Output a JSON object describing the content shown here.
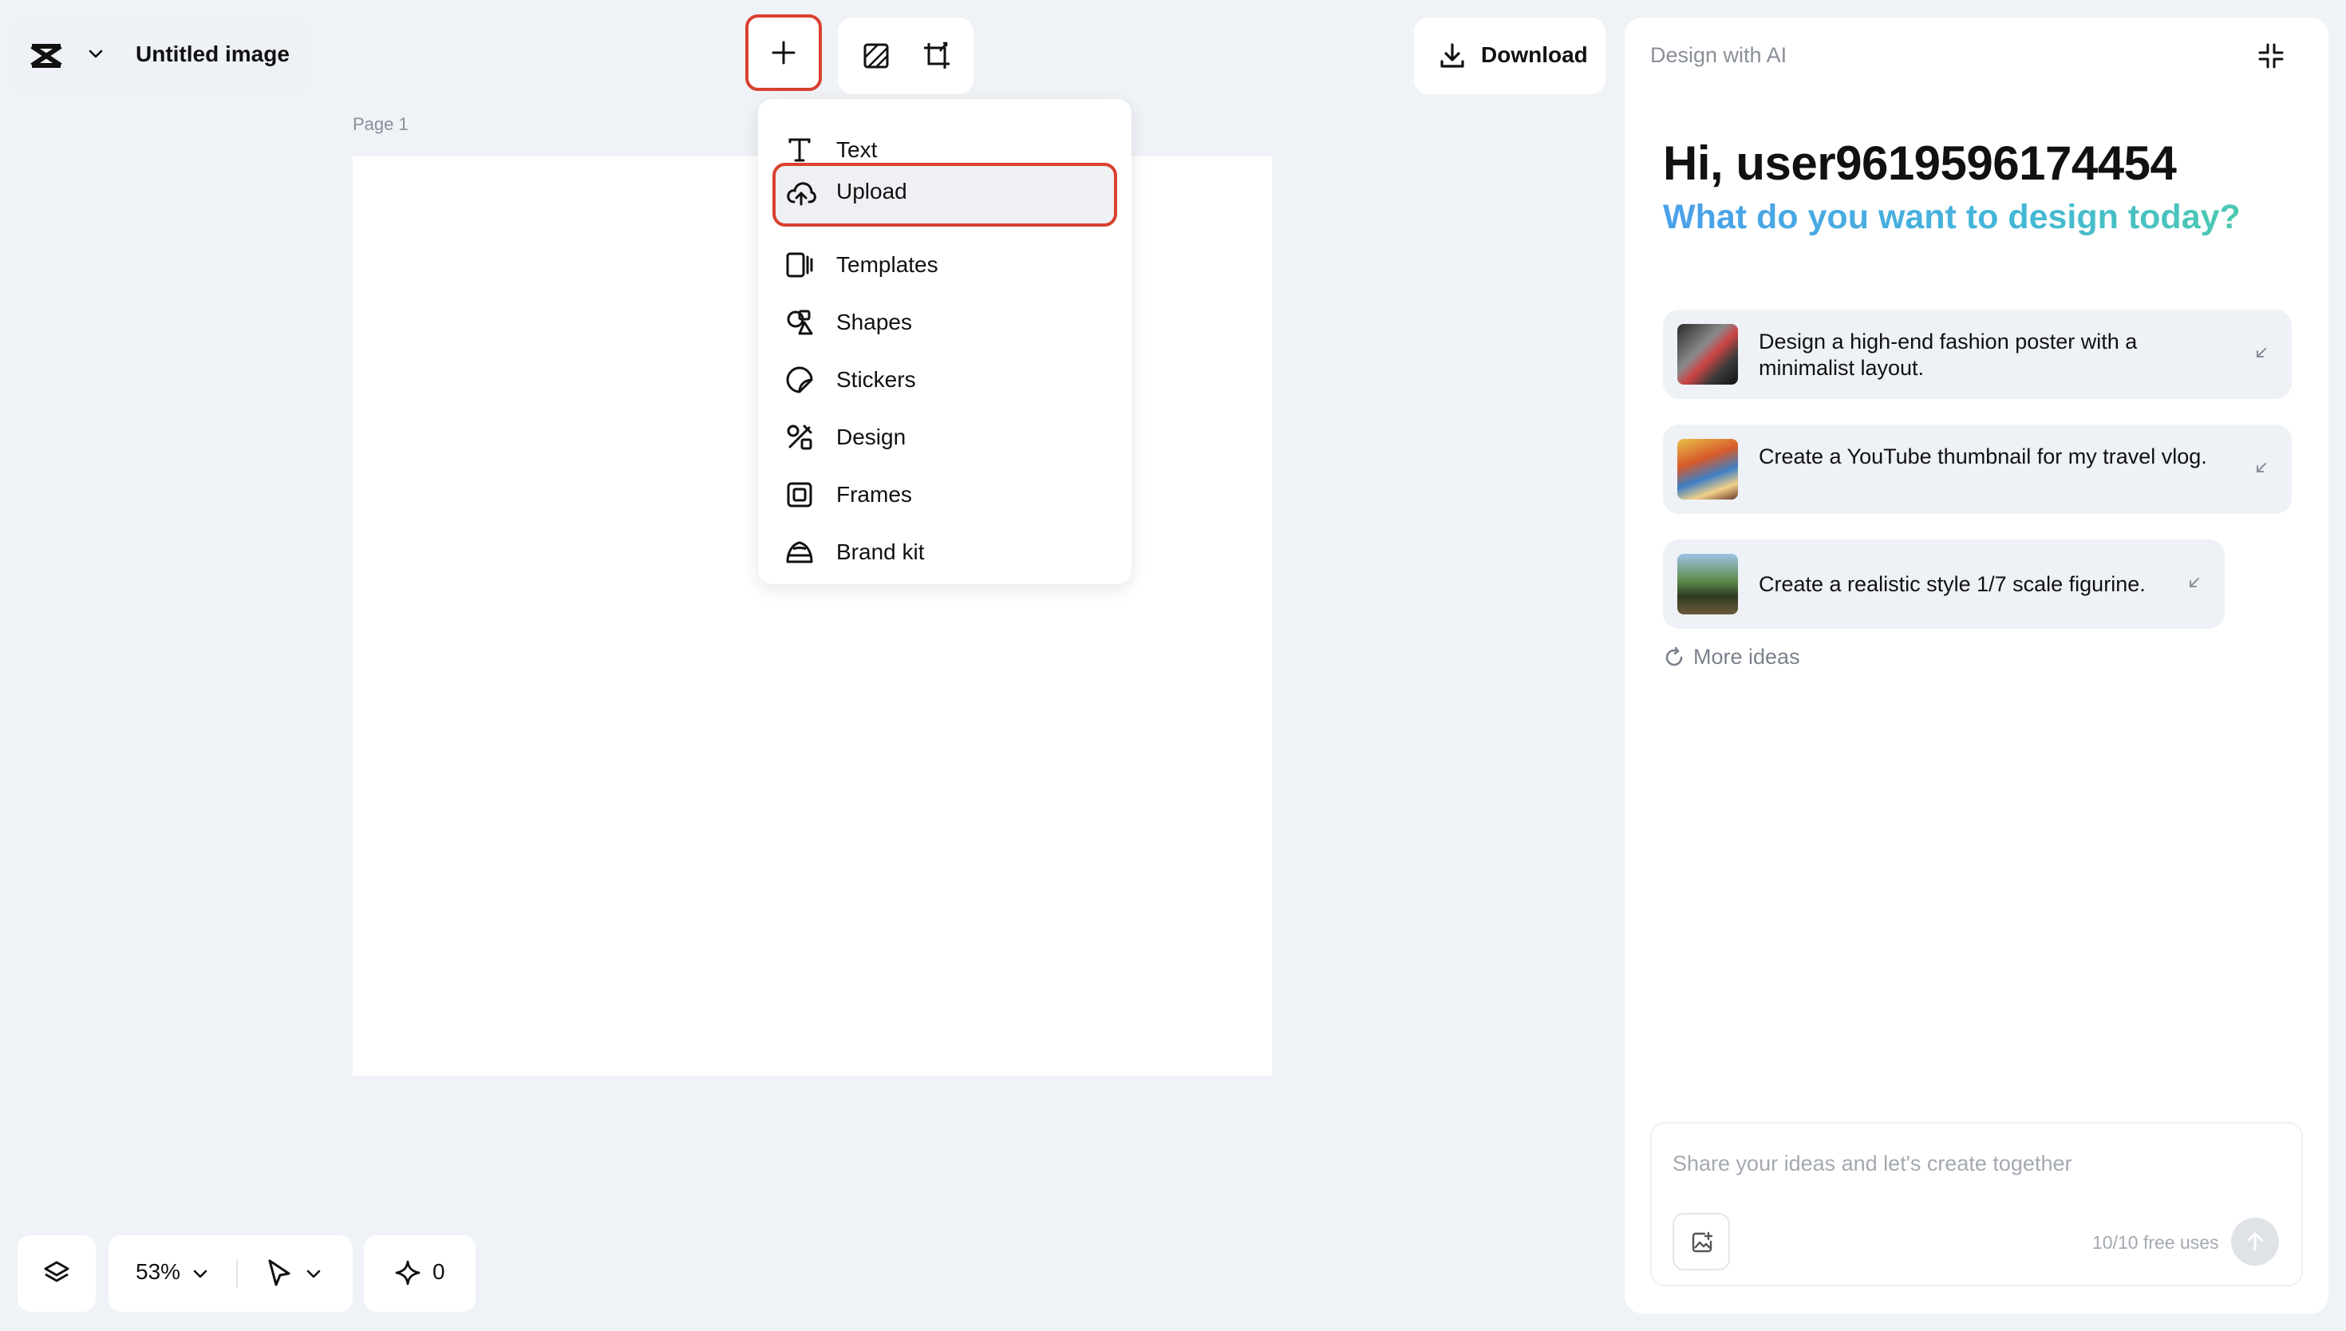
{
  "header": {
    "doc_title": "Untitled image",
    "download_label": "Download"
  },
  "canvas": {
    "page_label": "Page 1"
  },
  "add_menu": {
    "items": [
      {
        "label": "Text",
        "icon": "text-icon"
      },
      {
        "label": "Upload",
        "icon": "upload-cloud-icon"
      },
      {
        "label": "Templates",
        "icon": "templates-icon"
      },
      {
        "label": "Shapes",
        "icon": "shapes-icon"
      },
      {
        "label": "Stickers",
        "icon": "sticker-icon"
      },
      {
        "label": "Design",
        "icon": "design-icon"
      },
      {
        "label": "Frames",
        "icon": "frame-icon"
      },
      {
        "label": "Brand kit",
        "icon": "brand-kit-icon"
      }
    ]
  },
  "ai_panel": {
    "title": "Design with AI",
    "greeting": "Hi, user9619596174454",
    "subtitle": "What do you want to design today?",
    "ideas": [
      {
        "text": "Design a high-end fashion poster with a minimalist layout."
      },
      {
        "text": "Create a YouTube thumbnail for my travel vlog."
      },
      {
        "text": "Create a realistic style 1/7 scale figurine."
      }
    ],
    "more_ideas": "More ideas",
    "prompt_placeholder": "Share your ideas and let's create together",
    "usage": "10/10 free uses"
  },
  "bottom_bar": {
    "zoom": "53%",
    "credits": "0"
  },
  "colors": {
    "highlight": "#d9412f",
    "background": "#eff2f6",
    "accent_gradient_start": "#4aa0ea",
    "accent_gradient_end": "#4cc9b0"
  }
}
